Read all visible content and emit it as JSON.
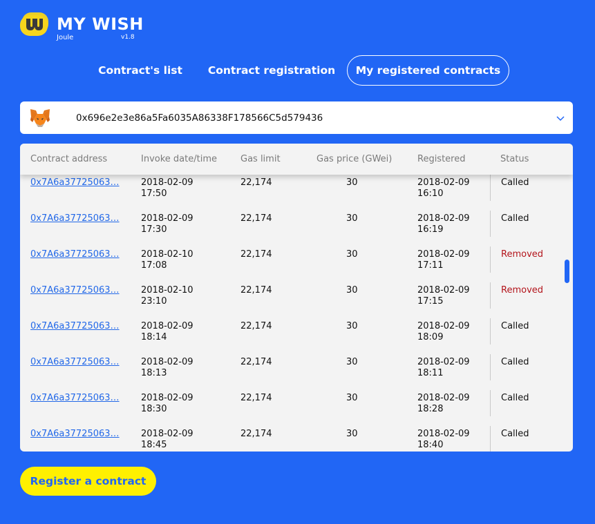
{
  "brand": {
    "title": "MY WISH",
    "subtitle": "Joule",
    "version": "v1.8",
    "logo_colors": {
      "yellow": "#f7d51c",
      "dark": "#3a3a3a"
    }
  },
  "tabs": [
    {
      "label": "Contract's list",
      "active": false
    },
    {
      "label": "Contract registration",
      "active": false
    },
    {
      "label": "My registered contracts",
      "active": true
    }
  ],
  "wallet": {
    "address": "0x696e2e3e86a5Fa6035A86338F178566C5d579436",
    "icon": "metamask-fox-icon"
  },
  "table": {
    "headers": {
      "address": "Contract address",
      "invoke": "Invoke date/time",
      "gas_limit": "Gas limit",
      "gas_price": "Gas price (GWei)",
      "registered": "Registered",
      "status": "Status"
    },
    "rows": [
      {
        "address": "0x7A6a37725063…",
        "invoke_date": "2018-02-09",
        "invoke_time": "17:50",
        "gas_limit": "22,174",
        "gas_price": "30",
        "reg_date": "2018-02-09",
        "reg_time": "16:10",
        "status": "Called"
      },
      {
        "address": "0x7A6a37725063…",
        "invoke_date": "2018-02-09",
        "invoke_time": "17:30",
        "gas_limit": "22,174",
        "gas_price": "30",
        "reg_date": "2018-02-09",
        "reg_time": "16:19",
        "status": "Called"
      },
      {
        "address": "0x7A6a37725063…",
        "invoke_date": "2018-02-10",
        "invoke_time": "17:08",
        "gas_limit": "22,174",
        "gas_price": "30",
        "reg_date": "2018-02-09",
        "reg_time": "17:11",
        "status": "Removed"
      },
      {
        "address": "0x7A6a37725063…",
        "invoke_date": "2018-02-10",
        "invoke_time": "23:10",
        "gas_limit": "22,174",
        "gas_price": "30",
        "reg_date": "2018-02-09",
        "reg_time": "17:15",
        "status": "Removed"
      },
      {
        "address": "0x7A6a37725063…",
        "invoke_date": "2018-02-09",
        "invoke_time": "18:14",
        "gas_limit": "22,174",
        "gas_price": "30",
        "reg_date": "2018-02-09",
        "reg_time": "18:09",
        "status": "Called"
      },
      {
        "address": "0x7A6a37725063…",
        "invoke_date": "2018-02-09",
        "invoke_time": "18:13",
        "gas_limit": "22,174",
        "gas_price": "30",
        "reg_date": "2018-02-09",
        "reg_time": "18:11",
        "status": "Called"
      },
      {
        "address": "0x7A6a37725063…",
        "invoke_date": "2018-02-09",
        "invoke_time": "18:30",
        "gas_limit": "22,174",
        "gas_price": "30",
        "reg_date": "2018-02-09",
        "reg_time": "18:28",
        "status": "Called"
      },
      {
        "address": "0x7A6a37725063…",
        "invoke_date": "2018-02-09",
        "invoke_time": "18:45",
        "gas_limit": "22,174",
        "gas_price": "30",
        "reg_date": "2018-02-09",
        "reg_time": "18:40",
        "status": "Called"
      }
    ]
  },
  "register_button": {
    "label": "Register a contract"
  },
  "colors": {
    "background": "#2166f5",
    "button": "#fff000",
    "link": "#2268e8",
    "removed": "#b3141b"
  }
}
